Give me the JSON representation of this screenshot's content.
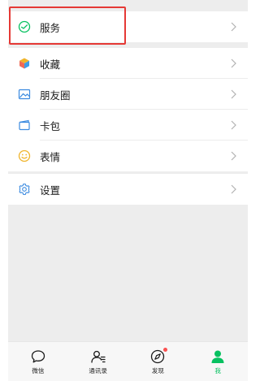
{
  "groups": [
    {
      "items": [
        {
          "label": "服务",
          "icon": "service-check-icon"
        }
      ]
    },
    {
      "items": [
        {
          "label": "收藏",
          "icon": "cube-favorites-icon"
        },
        {
          "label": "朋友圈",
          "icon": "image-moments-icon"
        },
        {
          "label": "卡包",
          "icon": "wallet-card-icon"
        },
        {
          "label": "表情",
          "icon": "smiley-sticker-icon"
        }
      ]
    },
    {
      "items": [
        {
          "label": "设置",
          "icon": "gear-icon"
        }
      ]
    }
  ],
  "tabbar": {
    "tabs": [
      {
        "label": "微信",
        "icon": "chat-bubble-icon"
      },
      {
        "label": "通讯录",
        "icon": "contacts-icon"
      },
      {
        "label": "发现",
        "icon": "compass-icon",
        "badge": "dot"
      },
      {
        "label": "我",
        "icon": "person-icon",
        "active": true
      }
    ]
  },
  "colors": {
    "accent": "#07c160",
    "highlight": "#e53935",
    "badge": "#fa5151",
    "background": "#ededed"
  }
}
